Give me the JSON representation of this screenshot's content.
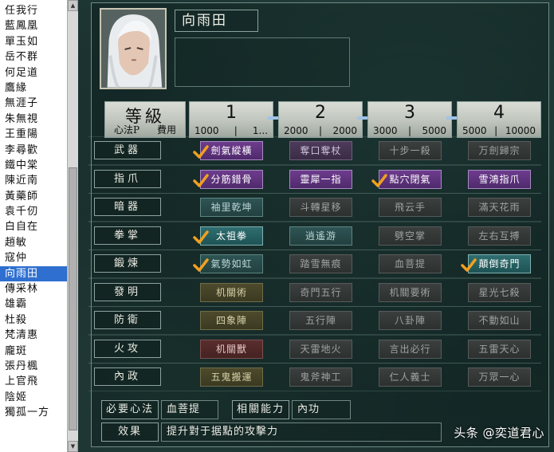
{
  "character_list": {
    "items": [
      "任我行",
      "藍鳳凰",
      "單玉如",
      "岳不群",
      "何足道",
      "鷹緣",
      "無涯子",
      "朱無視",
      "王重陽",
      "李尋歡",
      "鐵中棠",
      "陳近南",
      "黃藥師",
      "袁千仞",
      "白自在",
      "趙敏",
      "寇仲",
      "向雨田",
      "傳采林",
      "雄霸",
      "杜殺",
      "梵清惠",
      "龐斑",
      "張丹楓",
      "上官飛",
      "陰姬",
      "獨孤一方"
    ],
    "selected_index": 17
  },
  "character": {
    "name": "向雨田",
    "portrait_icon": "character-portrait-white-hair"
  },
  "header": {
    "title": "等級",
    "sub_left": "心法P",
    "sub_sep": "|",
    "sub_right": "費用",
    "levels": [
      {
        "num": "1",
        "cost_a": "1000",
        "cost_b": "1..."
      },
      {
        "num": "2",
        "cost_a": "2000",
        "cost_b": "2000"
      },
      {
        "num": "3",
        "cost_a": "3000",
        "cost_b": "5000"
      },
      {
        "num": "4",
        "cost_a": "5000",
        "cost_b": "10000"
      }
    ]
  },
  "rows": [
    {
      "label": "武器",
      "skills": [
        {
          "name": "劍氣縱橫",
          "style": "active-purple",
          "checked": true
        },
        {
          "name": "奪口奪杖",
          "style": "dim-purple",
          "checked": false
        },
        {
          "name": "十步一殺",
          "style": "gray",
          "checked": false
        },
        {
          "name": "万劍歸宗",
          "style": "gray",
          "checked": false
        }
      ]
    },
    {
      "label": "指爪",
      "skills": [
        {
          "name": "分筋錯骨",
          "style": "active-purple",
          "checked": true
        },
        {
          "name": "靈犀一指",
          "style": "active-purple",
          "checked": false
        },
        {
          "name": "點穴閉氣",
          "style": "active-purple",
          "checked": true
        },
        {
          "name": "雪鴻指爪",
          "style": "active-purple",
          "checked": false
        }
      ]
    },
    {
      "label": "暗器",
      "skills": [
        {
          "name": "袖里乾坤",
          "style": "dim-teal",
          "checked": false
        },
        {
          "name": "斗轉星移",
          "style": "gray",
          "checked": false
        },
        {
          "name": "飛云手",
          "style": "gray",
          "checked": false
        },
        {
          "name": "滿天花雨",
          "style": "gray",
          "checked": false
        }
      ]
    },
    {
      "label": "拳掌",
      "skills": [
        {
          "name": "太祖拳",
          "style": "active-teal",
          "checked": true
        },
        {
          "name": "逍遙游",
          "style": "dim-teal",
          "checked": false
        },
        {
          "name": "劈空掌",
          "style": "gray",
          "checked": false
        },
        {
          "name": "左右互搏",
          "style": "gray",
          "checked": false
        }
      ]
    },
    {
      "label": "鍛煉",
      "skills": [
        {
          "name": "氣勢如虹",
          "style": "dim-teal",
          "checked": true
        },
        {
          "name": "踏雪無痕",
          "style": "gray",
          "checked": false
        },
        {
          "name": "血菩提",
          "style": "gray",
          "checked": false
        },
        {
          "name": "顛倒奇門",
          "style": "active-teal",
          "checked": true
        }
      ]
    },
    {
      "label": "發明",
      "skills": [
        {
          "name": "机關術",
          "style": "dim-olive",
          "checked": false
        },
        {
          "name": "奇門五行",
          "style": "gray",
          "checked": false
        },
        {
          "name": "机關要術",
          "style": "gray",
          "checked": false
        },
        {
          "name": "星光七殺",
          "style": "gray",
          "checked": false
        }
      ]
    },
    {
      "label": "防衛",
      "skills": [
        {
          "name": "四象陣",
          "style": "dim-olive",
          "checked": false
        },
        {
          "name": "五行陣",
          "style": "gray",
          "checked": false
        },
        {
          "name": "八卦陣",
          "style": "gray",
          "checked": false
        },
        {
          "name": "不動如山",
          "style": "gray",
          "checked": false
        }
      ]
    },
    {
      "label": "火攻",
      "skills": [
        {
          "name": "机關獸",
          "style": "dim-red",
          "checked": false
        },
        {
          "name": "天雷地火",
          "style": "gray",
          "checked": false
        },
        {
          "name": "言出必行",
          "style": "gray",
          "checked": false
        },
        {
          "name": "五雷天心",
          "style": "gray",
          "checked": false
        }
      ]
    },
    {
      "label": "內政",
      "skills": [
        {
          "name": "五鬼搬運",
          "style": "dim-olive",
          "checked": false
        },
        {
          "name": "鬼斧神工",
          "style": "gray",
          "checked": false
        },
        {
          "name": "仁人義士",
          "style": "gray",
          "checked": false
        },
        {
          "name": "万眾一心",
          "style": "gray",
          "checked": false
        }
      ]
    }
  ],
  "footer": {
    "required_label": "必要心法",
    "required_value": "血菩提",
    "related_label": "相關能力",
    "related_value": "內功",
    "effect_label": "效果",
    "effect_value": "提升對于据點的攻擊力"
  },
  "watermark": "头条 @奕道君心",
  "colors": {
    "selected_bg": "#2f6fd0",
    "check": "#f0a020",
    "arrow": "#9fc3e8"
  }
}
